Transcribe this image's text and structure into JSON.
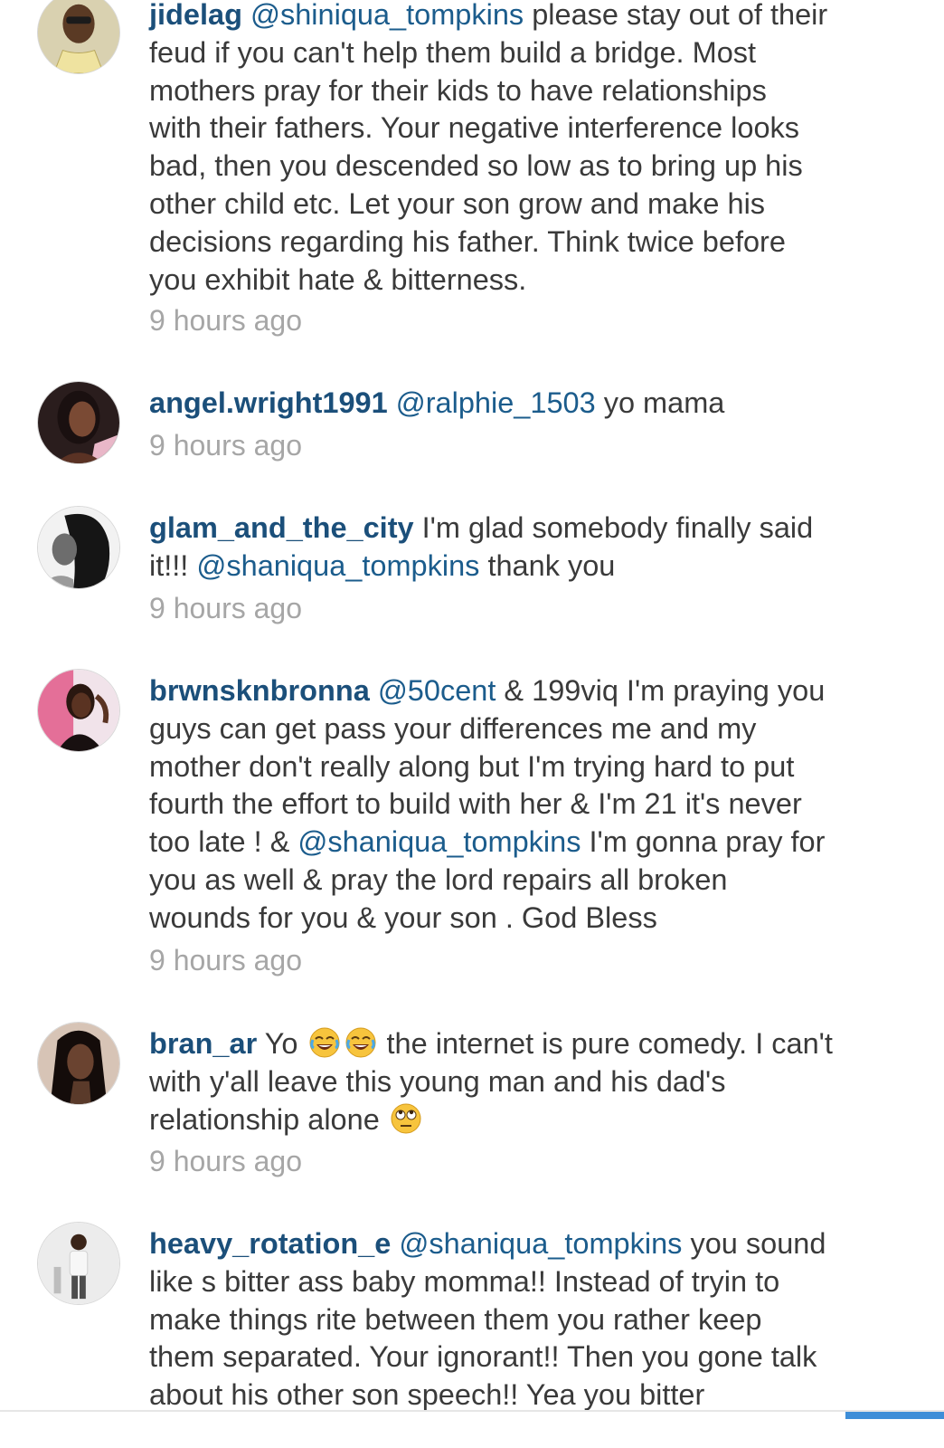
{
  "comments": [
    {
      "username": "jidelag",
      "lines": [
        [
          {
            "t": "mention",
            "v": "@shiniqua_tompkins"
          },
          {
            "t": "text",
            "v": " please stay out of their"
          }
        ],
        [
          {
            "t": "text",
            "v": "feud if you can't help them build a bridge. Most"
          }
        ],
        [
          {
            "t": "text",
            "v": "mothers pray for their kids to have relationships"
          }
        ],
        [
          {
            "t": "text",
            "v": "with their fathers. Your negative interference looks"
          }
        ],
        [
          {
            "t": "text",
            "v": "bad, then you descended so low as to bring up his"
          }
        ],
        [
          {
            "t": "text",
            "v": "other child etc. Let your son grow and make his"
          }
        ],
        [
          {
            "t": "text",
            "v": "decisions regarding his father. Think twice before"
          }
        ],
        [
          {
            "t": "text",
            "v": "you exhibit hate & bitterness."
          }
        ]
      ],
      "timestamp": "9 hours ago",
      "avatar_icon": "user-avatar-man-sunglasses"
    },
    {
      "username": "angel.wright1991",
      "lines": [
        [
          {
            "t": "mention",
            "v": "@ralphie_1503"
          },
          {
            "t": "text",
            "v": " yo mama"
          }
        ]
      ],
      "timestamp": "9 hours ago",
      "avatar_icon": "user-avatar-woman-dark"
    },
    {
      "username": "glam_and_the_city",
      "lines": [
        [
          {
            "t": "text",
            "v": "I'm glad somebody finally said"
          }
        ],
        [
          {
            "t": "text",
            "v": "it!!! "
          },
          {
            "t": "mention",
            "v": "@shaniqua_tompkins"
          },
          {
            "t": "text",
            "v": " thank you"
          }
        ]
      ],
      "timestamp": "9 hours ago",
      "avatar_icon": "user-avatar-grayscale-hair"
    },
    {
      "username": "brwnsknbronna",
      "lines": [
        [
          {
            "t": "mention",
            "v": "@50cent"
          },
          {
            "t": "text",
            "v": " & 199viq I'm praying you"
          }
        ],
        [
          {
            "t": "text",
            "v": "guys can get pass your differences me and my"
          }
        ],
        [
          {
            "t": "text",
            "v": "mother don't really along but I'm trying hard to put"
          }
        ],
        [
          {
            "t": "text",
            "v": "fourth the effort to build with her &  I'm 21 it's never"
          }
        ],
        [
          {
            "t": "text",
            "v": "too late ! & "
          },
          {
            "t": "mention",
            "v": "@shaniqua_tompkins"
          },
          {
            "t": "text",
            "v": " I'm gonna pray for"
          }
        ],
        [
          {
            "t": "text",
            "v": "you as well & pray the lord repairs all broken"
          }
        ],
        [
          {
            "t": "text",
            "v": "wounds for you & your son . God Bless"
          }
        ]
      ],
      "timestamp": "9 hours ago",
      "avatar_icon": "user-avatar-woman-pink"
    },
    {
      "username": "bran_ar",
      "lines": [
        [
          {
            "t": "text",
            "v": "Yo "
          },
          {
            "t": "emoji",
            "v": "joy-emoji"
          },
          {
            "t": "emoji",
            "v": "joy-emoji"
          },
          {
            "t": "text",
            "v": " the internet is pure comedy. I can't"
          }
        ],
        [
          {
            "t": "text",
            "v": "with y'all leave this young man and his dad's"
          }
        ],
        [
          {
            "t": "text",
            "v": "relationship alone "
          },
          {
            "t": "emoji",
            "v": "rolling-eyes-emoji"
          }
        ]
      ],
      "timestamp": "9 hours ago",
      "avatar_icon": "user-avatar-woman-long-hair"
    },
    {
      "username": "heavy_rotation_e",
      "lines": [
        [
          {
            "t": "mention",
            "v": "@shaniqua_tompkins"
          },
          {
            "t": "text",
            "v": " you sound"
          }
        ],
        [
          {
            "t": "text",
            "v": "like s bitter ass baby momma!! Instead of tryin to"
          }
        ],
        [
          {
            "t": "text",
            "v": "make things rite between them you rather keep"
          }
        ],
        [
          {
            "t": "text",
            "v": "them separated. Your ignorant!! Then you gone talk"
          }
        ],
        [
          {
            "t": "text",
            "v": "about his other son speech!! Yea you bitter"
          }
        ]
      ],
      "timestamp": "",
      "avatar_icon": "user-avatar-man-standing"
    }
  ],
  "colors": {
    "username": "#1b4f7a",
    "mention": "#1b5c8c",
    "text": "#3a3a3a",
    "timestamp": "#a6a6a6",
    "accent": "#3e8ed8"
  }
}
